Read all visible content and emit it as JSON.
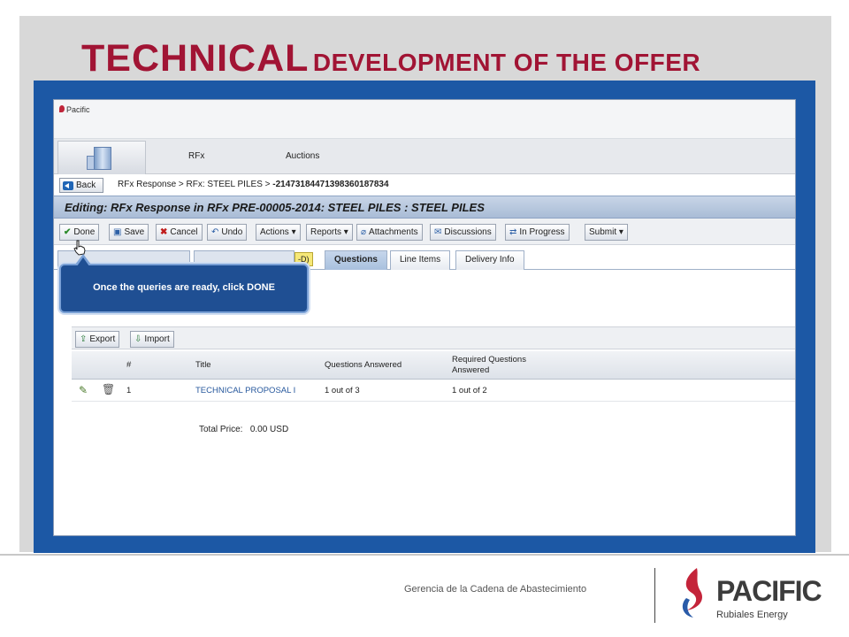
{
  "slide": {
    "title_big": "TECHNICAL",
    "title_rest": "DEVELOPMENT OF THE OFFER",
    "footer_text": "Gerencia de la Cadena de Abastecimiento",
    "logo_word": "PACIFIC",
    "logo_sub": "Rubiales Energy",
    "accent_color": "#a11434",
    "frame_color": "#1c58a5"
  },
  "app": {
    "mini_logo": "Pacific",
    "nav": {
      "items": [
        "RFx",
        "Auctions"
      ]
    },
    "breadcrumb": {
      "back_label": "Back",
      "trail": "RFx Response  >  RFx: STEEL PILES  >",
      "id": "-2147318447139836018783‍4"
    },
    "editing_title": "Editing: RFx Response in RFx PRE-00005-2014: STEEL PILES : STEEL PILES",
    "toolbar": {
      "done": "Done",
      "save": "Save",
      "cancel": "Cancel",
      "undo": "Undo",
      "actions": "Actions",
      "reports": "Reports",
      "attachments": "Attachments",
      "discussions": "Discussions",
      "in_progress": "In Progress",
      "submit": "Submit"
    },
    "tabs": {
      "badge": "-D)",
      "questions": "Questions",
      "line_items": "Line Items",
      "delivery_info": "Delivery Info"
    },
    "tooltip": "Once the queries are ready, click DONE",
    "grid": {
      "export": "Export",
      "import": "Import",
      "headers": {
        "num": "#",
        "title": "Title",
        "answered": "Questions Answered",
        "required_1": "Required Questions",
        "required_2": "Answered"
      },
      "rows": [
        {
          "num": "1",
          "title": "TECHNICAL PROPOSAL I",
          "answered": "1 out of 3",
          "required": "1 out of 2"
        }
      ]
    },
    "total_label": "Total Price:",
    "total_value": "0.00 USD"
  }
}
